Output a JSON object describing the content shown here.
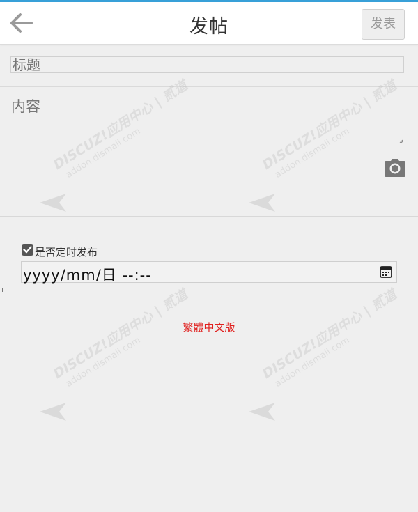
{
  "header": {
    "title": "发帖",
    "publish_label": "发表",
    "back_icon": "arrow-left-icon",
    "accent_color": "#38a0d8"
  },
  "form": {
    "subject_placeholder": "标题",
    "content_placeholder": "内容",
    "upload_icon": "camera-icon",
    "timer_checked": true,
    "timer_label": "是否定时发布",
    "datetime_placeholder": "yyyy/mm/日  --:--",
    "calendar_icon": "calendar-icon"
  },
  "footer": {
    "lang_link": "繁體中文版",
    "lang_link_color": "#e0201e"
  },
  "watermark": {
    "brand": "DISCUZ!应用中心 | 贰道",
    "url": "addon.dismall.com"
  }
}
